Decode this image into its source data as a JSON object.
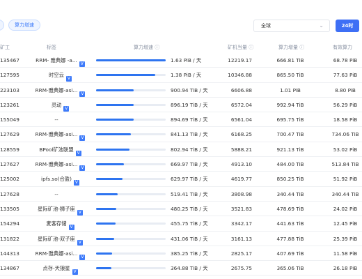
{
  "filters": {
    "left_cut_label": "",
    "speed_pill": "算力增速",
    "region_select": "全球",
    "period_button": "24时"
  },
  "table": {
    "headers": {
      "miner": "矿工",
      "tag": "标签",
      "speed": "算力增速",
      "equivalent": "矿机当量",
      "increment": "算力增量",
      "effective": "有效算力"
    },
    "rows": [
      {
        "miner": "135467",
        "tag": "RRM- 雅典娜 -a...",
        "verified": true,
        "speed_fraction": 1.0,
        "speed": "1.63 PiB / 天",
        "equivalent": "12219.17",
        "increment": "666.81 TiB",
        "effective": "68.78 PiB"
      },
      {
        "miner": "127595",
        "tag": "时空云",
        "verified": true,
        "speed_fraction": 0.85,
        "speed": "1.38 PiB / 天",
        "equivalent": "10346.88",
        "increment": "865.50 TiB",
        "effective": "77.63 PiB"
      },
      {
        "miner": "223103",
        "tag": "RRM-雅典娜-asi...",
        "verified": true,
        "speed_fraction": 0.54,
        "speed": "900.94 TiB / 天",
        "equivalent": "6606.88",
        "increment": "1.01 PiB",
        "effective": "8.80 PiB"
      },
      {
        "miner": "123261",
        "tag": "灵动",
        "verified": true,
        "speed_fraction": 0.54,
        "speed": "896.19 TiB / 天",
        "equivalent": "6572.04",
        "increment": "992.94 TiB",
        "effective": "56.29 PiB"
      },
      {
        "miner": "155049",
        "tag": "--",
        "verified": false,
        "speed_fraction": 0.54,
        "speed": "894.69 TiB / 天",
        "equivalent": "6561.04",
        "increment": "695.75 TiB",
        "effective": "18.58 PiB"
      },
      {
        "miner": "127629",
        "tag": "RRM-雅典娜-asi...",
        "verified": true,
        "speed_fraction": 0.5,
        "speed": "841.13 TiB / 天",
        "equivalent": "6168.25",
        "increment": "700.47 TiB",
        "effective": "734.06 TiB"
      },
      {
        "miner": "128559",
        "tag": "BPool矿池联盟",
        "verified": true,
        "speed_fraction": 0.48,
        "speed": "802.94 TiB / 天",
        "equivalent": "5888.21",
        "increment": "921.13 TiB",
        "effective": "53.02 PiB"
      },
      {
        "miner": "127627",
        "tag": "RRM-雅典娜-asi...",
        "verified": true,
        "speed_fraction": 0.4,
        "speed": "669.97 TiB / 天",
        "equivalent": "4913.10",
        "increment": "484.00 TiB",
        "effective": "513.84 TiB"
      },
      {
        "miner": "125002",
        "tag": "ipfs.so(合盈)",
        "verified": true,
        "speed_fraction": 0.38,
        "speed": "629.97 TiB / 天",
        "equivalent": "4619.77",
        "increment": "850.25 TiB",
        "effective": "51.92 PiB"
      },
      {
        "miner": "127628",
        "tag": "--",
        "verified": false,
        "speed_fraction": 0.31,
        "speed": "519.41 TiB / 天",
        "equivalent": "3808.98",
        "increment": "340.44 TiB",
        "effective": "340.44 TiB"
      },
      {
        "miner": "133505",
        "tag": "星际矿池-狮子座",
        "verified": true,
        "speed_fraction": 0.29,
        "speed": "480.25 TiB / 天",
        "equivalent": "3521.83",
        "increment": "478.69 TiB",
        "effective": "24.02 PiB"
      },
      {
        "miner": "154294",
        "tag": "麦客存储",
        "verified": true,
        "speed_fraction": 0.28,
        "speed": "455.75 TiB / 天",
        "equivalent": "3342.17",
        "increment": "441.63 TiB",
        "effective": "12.45 PiB"
      },
      {
        "miner": "131822",
        "tag": "星际矿池-双子座",
        "verified": true,
        "speed_fraction": 0.26,
        "speed": "431.06 TiB / 天",
        "equivalent": "3161.13",
        "increment": "477.88 TiB",
        "effective": "25.39 PiB"
      },
      {
        "miner": "144313",
        "tag": "RRM-雅典娜-asi...",
        "verified": true,
        "speed_fraction": 0.23,
        "speed": "385.25 TiB / 天",
        "equivalent": "2825.17",
        "increment": "407.69 TiB",
        "effective": "11.58 PiB"
      },
      {
        "miner": "134867",
        "tag": "点存-天狼星",
        "verified": true,
        "speed_fraction": 0.22,
        "speed": "364.88 TiB / 天",
        "equivalent": "2675.75",
        "increment": "365.06 TiB",
        "effective": "26.18 PiB"
      }
    ]
  },
  "colors": {
    "accent": "#2e74f0",
    "badge": "#3e7bfa",
    "button": "#3e6ff5"
  },
  "icons": {
    "verified": "v-badge-icon",
    "info": "info-circle-icon",
    "chevron": "chevron-down-icon"
  }
}
